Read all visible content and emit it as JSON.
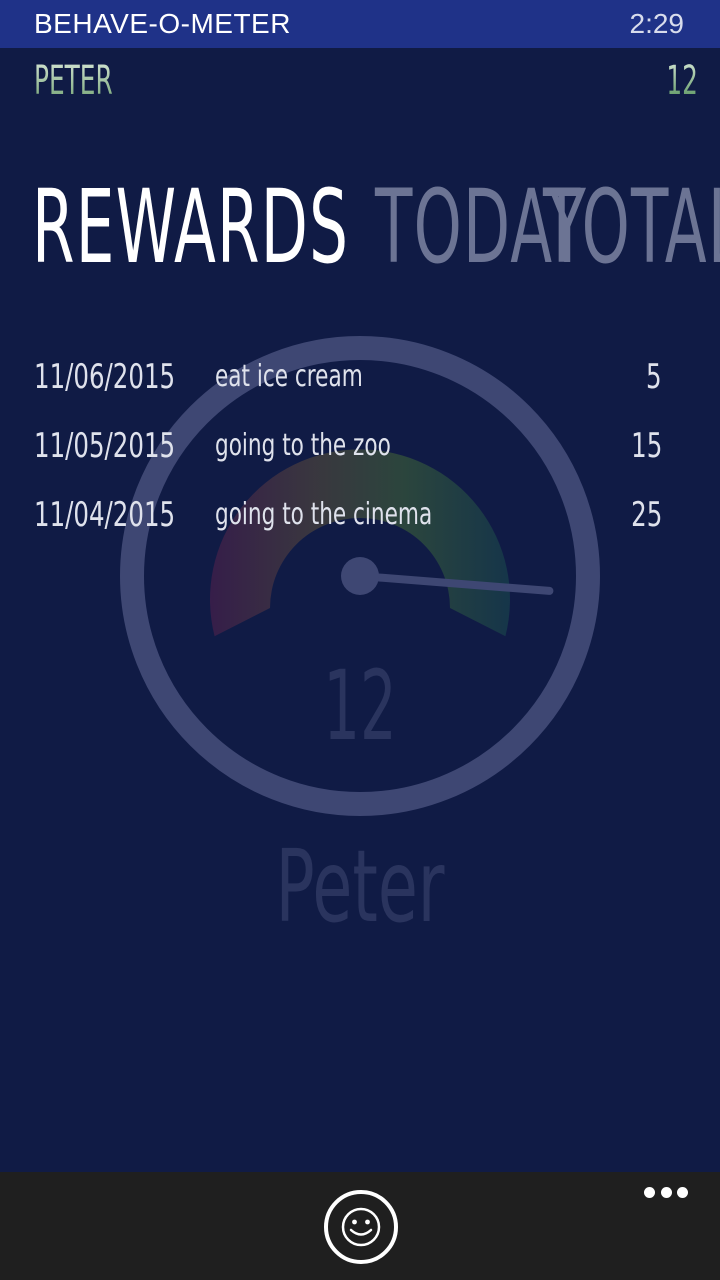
{
  "status_bar": {
    "app_title": "BEHAVE-O-METER",
    "time": "2:29"
  },
  "header": {
    "name": "PETER",
    "score": "12"
  },
  "pivot": {
    "tabs": [
      {
        "label": "REWARDS",
        "active": true
      },
      {
        "label": "TODAY",
        "active": false
      },
      {
        "label": "TOTAL",
        "active": false
      }
    ]
  },
  "gauge": {
    "value": "12",
    "name": "Peter",
    "needle_fraction": 0.85
  },
  "rewards": [
    {
      "date": "11/06/2015",
      "description": "eat ice cream",
      "points": "5"
    },
    {
      "date": "11/05/2015",
      "description": "going to the zoo",
      "points": "15"
    },
    {
      "date": "11/04/2015",
      "description": "going to the cinema",
      "points": "25"
    }
  ],
  "app_bar": {
    "primary_icon": "smiley-icon",
    "more_icon": "more-dots-icon"
  },
  "colors": {
    "background": "#101b45",
    "status_bar": "#1f3288",
    "app_bar": "#1f1f1f"
  }
}
